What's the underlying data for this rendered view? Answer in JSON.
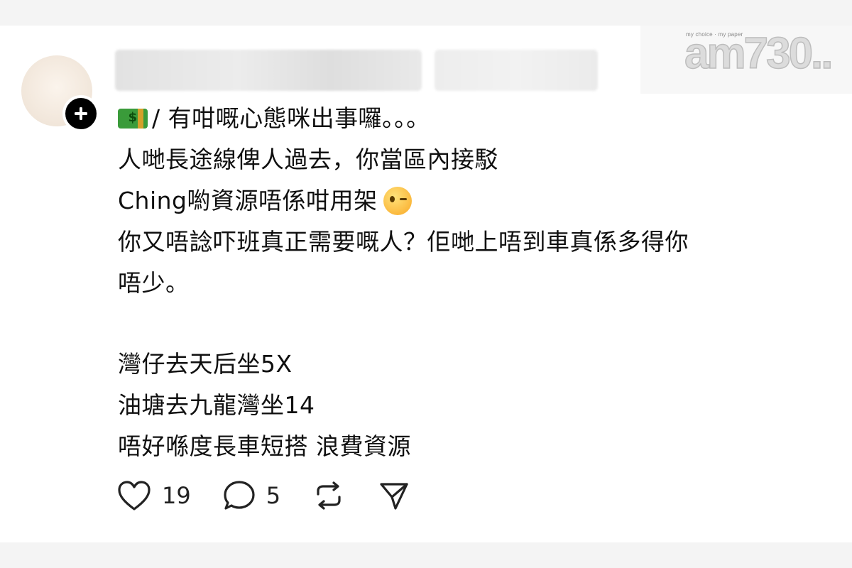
{
  "brand": {
    "logo_text": "am730..",
    "tagline": "my choice · my paper"
  },
  "post": {
    "lines": [
      "/ 有咁嘅心態咪出事囉。。。",
      "人哋長途線俾人過去，你當區內接駁",
      "Ching喲資源唔係咁用架",
      "你又唔諗吓班真正需要嘅人？佢哋上唔到車真係多得你",
      "唔少。",
      "灣仔去天后坐5X",
      "油塘去九龍灣坐14",
      "唔好喺度長車短搭 浪費資源"
    ]
  },
  "actions": {
    "like_count": "19",
    "comment_count": "5"
  },
  "icons": {
    "follow": "plus-icon",
    "like": "heart-icon",
    "comment": "speech-bubble-icon",
    "repost": "repost-icon",
    "share": "paper-plane-icon",
    "money_emoji": "money-emoji-icon",
    "wink_emoji": "wink-emoji-icon"
  },
  "colors": {
    "background": "#f4f4f4",
    "card": "#ffffff",
    "text": "#101010",
    "icon": "#222222"
  }
}
